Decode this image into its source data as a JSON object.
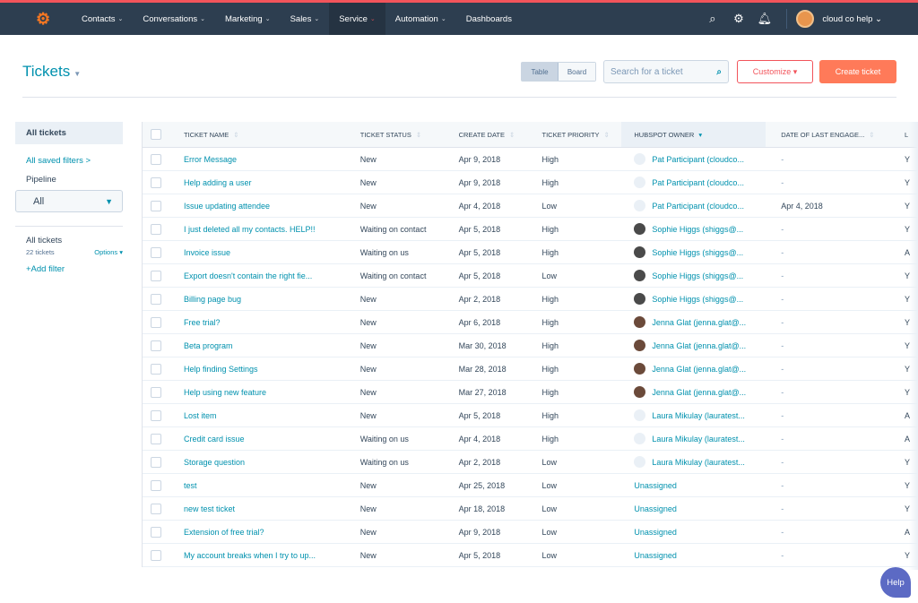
{
  "nav": {
    "items": [
      {
        "label": "Contacts",
        "chev": true
      },
      {
        "label": "Conversations",
        "chev": true
      },
      {
        "label": "Marketing",
        "chev": true
      },
      {
        "label": "Sales",
        "chev": true
      },
      {
        "label": "Service",
        "chev": true,
        "active": true
      },
      {
        "label": "Automation",
        "chev": true
      },
      {
        "label": "Dashboards",
        "chev": false
      }
    ],
    "user": "cloud co help ⌄"
  },
  "header": {
    "title": "Tickets",
    "view_table": "Table",
    "view_board": "Board",
    "search_placeholder": "Search for a ticket",
    "customize": "Customize ▾",
    "create": "Create ticket"
  },
  "sidebar": {
    "all_tickets": "All tickets",
    "saved_filters": "All saved filters >",
    "pipeline_label": "Pipeline",
    "pipeline_value": "All",
    "view_name": "All tickets",
    "count": "22 tickets",
    "options": "Options ▾",
    "add_filter": "+Add filter"
  },
  "table": {
    "columns": [
      "TICKET NAME",
      "TICKET STATUS",
      "CREATE DATE",
      "TICKET PRIORITY",
      "HUBSPOT OWNER",
      "DATE OF LAST ENGAGE...",
      "L"
    ],
    "rows": [
      [
        "Error Message",
        "New",
        "Apr 9, 2018",
        "High",
        "Pat Participant (cloudco...",
        "-",
        "Y",
        "g"
      ],
      [
        "Help adding a user",
        "New",
        "Apr 9, 2018",
        "High",
        "Pat Participant (cloudco...",
        "-",
        "Y",
        "g"
      ],
      [
        "Issue updating attendee",
        "New",
        "Apr 4, 2018",
        "Low",
        "Pat Participant (cloudco...",
        "Apr 4, 2018",
        "Y",
        "g"
      ],
      [
        "I just deleted all my contacts. HELP!!",
        "Waiting on contact",
        "Apr 5, 2018",
        "High",
        "Sophie Higgs (shiggs@...",
        "-",
        "Y",
        "s"
      ],
      [
        "Invoice issue",
        "Waiting on us",
        "Apr 5, 2018",
        "High",
        "Sophie Higgs (shiggs@...",
        "-",
        "A",
        "s"
      ],
      [
        "Export doesn't contain the right fie...",
        "Waiting on contact",
        "Apr 5, 2018",
        "Low",
        "Sophie Higgs (shiggs@...",
        "-",
        "Y",
        "s"
      ],
      [
        "Billing page bug",
        "New",
        "Apr 2, 2018",
        "High",
        "Sophie Higgs (shiggs@...",
        "-",
        "Y",
        "s"
      ],
      [
        "Free trial?",
        "New",
        "Apr 6, 2018",
        "High",
        "Jenna Glat (jenna.glat@...",
        "-",
        "Y",
        "j"
      ],
      [
        "Beta program",
        "New",
        "Mar 30, 2018",
        "High",
        "Jenna Glat (jenna.glat@...",
        "-",
        "Y",
        "j"
      ],
      [
        "Help finding Settings",
        "New",
        "Mar 28, 2018",
        "High",
        "Jenna Glat (jenna.glat@...",
        "-",
        "Y",
        "j"
      ],
      [
        "Help using new feature",
        "New",
        "Mar 27, 2018",
        "High",
        "Jenna Glat (jenna.glat@...",
        "-",
        "Y",
        "j"
      ],
      [
        "Lost item",
        "New",
        "Apr 5, 2018",
        "High",
        "Laura Mikulay (lauratest...",
        "-",
        "A",
        "g"
      ],
      [
        "Credit card issue",
        "Waiting on us",
        "Apr 4, 2018",
        "High",
        "Laura Mikulay (lauratest...",
        "-",
        "A",
        "g"
      ],
      [
        "Storage question",
        "Waiting on us",
        "Apr 2, 2018",
        "Low",
        "Laura Mikulay (lauratest...",
        "-",
        "Y",
        "g"
      ],
      [
        "test",
        "New",
        "Apr 25, 2018",
        "Low",
        "Unassigned",
        "-",
        "Y",
        ""
      ],
      [
        "new test ticket",
        "New",
        "Apr 18, 2018",
        "Low",
        "Unassigned",
        "-",
        "Y",
        ""
      ],
      [
        "Extension of free trial?",
        "New",
        "Apr 9, 2018",
        "Low",
        "Unassigned",
        "-",
        "A",
        ""
      ],
      [
        "My account breaks when I try to up...",
        "New",
        "Apr 5, 2018",
        "Low",
        "Unassigned",
        "-",
        "Y",
        ""
      ]
    ]
  },
  "help": "Help",
  "colors": {
    "nav_bg": "#2d3e50",
    "accent": "#0091ae",
    "primary_button": "#ff7a59",
    "help_button": "#5c6ac4"
  }
}
